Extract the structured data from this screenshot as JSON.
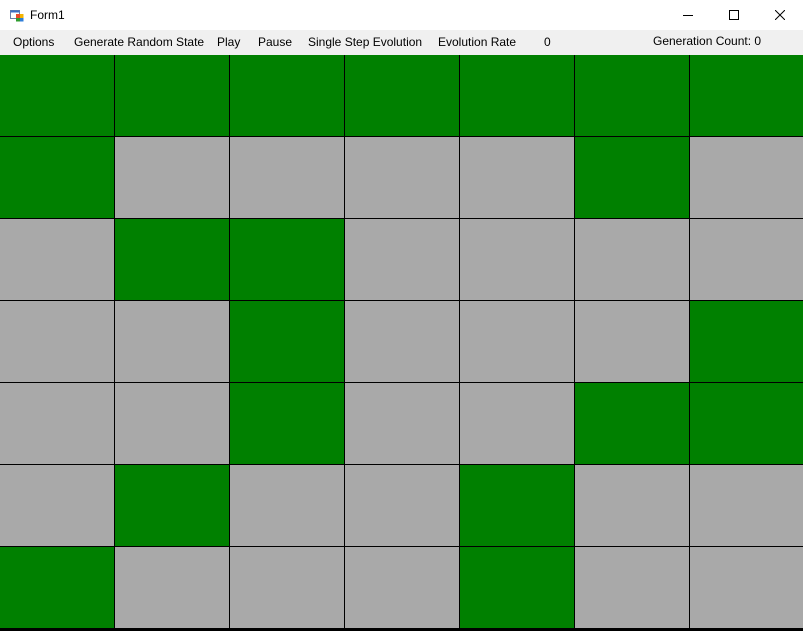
{
  "window": {
    "title": "Form1",
    "icon": "windows-form-icon"
  },
  "menu": {
    "options": "Options",
    "generate_random_state": "Generate Random State",
    "play": "Play",
    "pause": "Pause",
    "single_step": "Single Step Evolution",
    "evolution_rate_label": "Evolution Rate",
    "evolution_rate_value": "0",
    "generation_count": "Generation Count: 0"
  },
  "colors": {
    "alive": "#008000",
    "dead": "#a9a9a9",
    "grid_line": "#000000"
  },
  "grid": {
    "rows": 7,
    "cols": 7,
    "cells": [
      [
        1,
        1,
        1,
        1,
        1,
        1,
        1
      ],
      [
        1,
        0,
        0,
        0,
        0,
        1,
        0
      ],
      [
        0,
        1,
        1,
        0,
        0,
        0,
        0
      ],
      [
        0,
        0,
        1,
        0,
        0,
        0,
        1
      ],
      [
        0,
        0,
        1,
        0,
        0,
        1,
        1
      ],
      [
        0,
        1,
        0,
        0,
        1,
        0,
        0
      ],
      [
        1,
        0,
        0,
        0,
        1,
        0,
        0
      ]
    ]
  }
}
